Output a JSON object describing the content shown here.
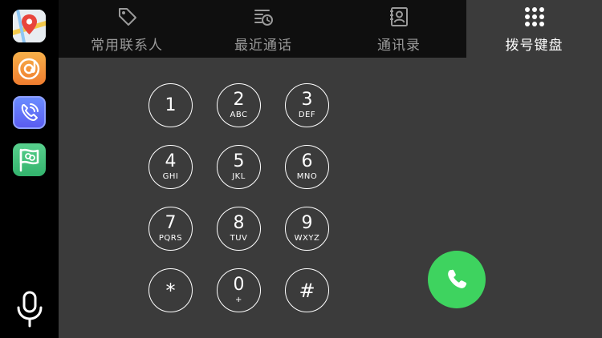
{
  "sidebar": {
    "apps": [
      {
        "name": "maps-app",
        "icon": "map-pin-icon"
      },
      {
        "name": "music-app",
        "icon": "music-disc-icon"
      },
      {
        "name": "phone-app",
        "icon": "phone-signal-icon"
      },
      {
        "name": "chat-app",
        "icon": "chat-flag-icon"
      }
    ],
    "mic_icon": "microphone-icon"
  },
  "tabs": [
    {
      "label": "常用联系人",
      "icon": "tag-icon",
      "active": false
    },
    {
      "label": "最近通话",
      "icon": "recent-list-icon",
      "active": false
    },
    {
      "label": "通讯录",
      "icon": "contacts-book-icon",
      "active": false
    },
    {
      "label": "拨号键盘",
      "icon": "dialpad-grid-icon",
      "active": true
    }
  ],
  "keypad": [
    {
      "digit": "1",
      "letters": ""
    },
    {
      "digit": "2",
      "letters": "ABC"
    },
    {
      "digit": "3",
      "letters": "DEF"
    },
    {
      "digit": "4",
      "letters": "GHI"
    },
    {
      "digit": "5",
      "letters": "JKL"
    },
    {
      "digit": "6",
      "letters": "MNO"
    },
    {
      "digit": "7",
      "letters": "PQRS"
    },
    {
      "digit": "8",
      "letters": "TUV"
    },
    {
      "digit": "9",
      "letters": "WXYZ"
    },
    {
      "digit": "*",
      "letters": ""
    },
    {
      "digit": "0",
      "letters": "+"
    },
    {
      "digit": "#",
      "letters": ""
    }
  ],
  "call_button": {
    "icon": "phone-call-icon",
    "color": "#3ed35f"
  },
  "colors": {
    "background": "#3b3b3b",
    "tabbar": "#0f0f0f",
    "sidebar": "#000000",
    "accent_green": "#3ed35f"
  }
}
